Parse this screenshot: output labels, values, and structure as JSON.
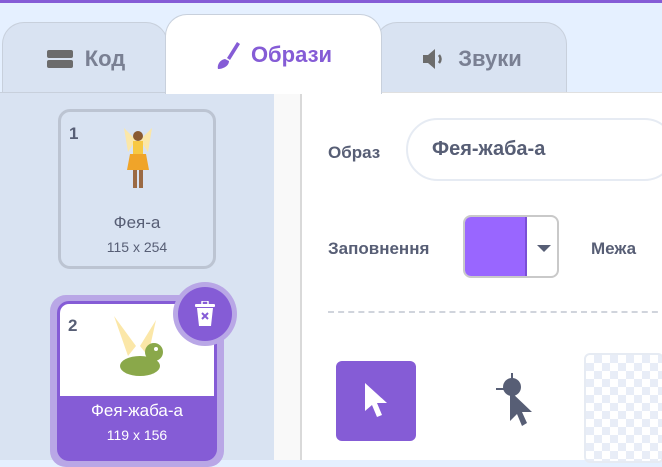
{
  "tabs": [
    {
      "label": "Код",
      "icon": "code-blocks-icon"
    },
    {
      "label": "Образи",
      "icon": "brush-icon",
      "active": true
    },
    {
      "label": "Звуки",
      "icon": "speaker-icon"
    }
  ],
  "costumes": [
    {
      "number": "1",
      "name": "Фея-а",
      "size": "115 x 254"
    },
    {
      "number": "2",
      "name": "Фея-жаба-а",
      "size": "119 x 156",
      "selected": true
    }
  ],
  "editor": {
    "costume_label": "Образ",
    "costume_name": "Фея-жаба-а",
    "fill_label": "Заповнення",
    "fill_color": "#9966ff",
    "outline_label": "Межа"
  },
  "colors": {
    "accent": "#855cd6",
    "text": "#575e75"
  }
}
